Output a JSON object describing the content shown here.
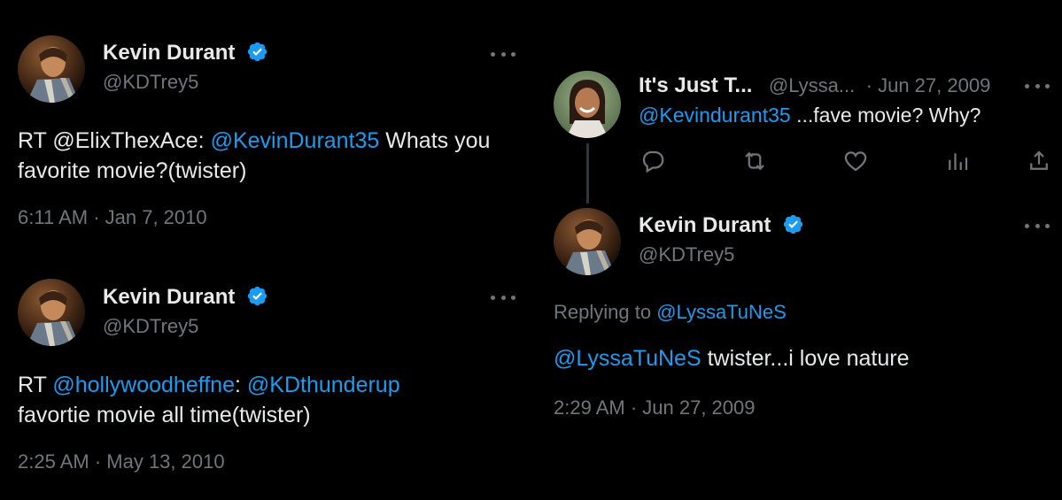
{
  "left_tweets": [
    {
      "name": "Kevin Durant",
      "handle": "@KDTrey5",
      "body_prefix": "RT @ElixThexAce: ",
      "body_link": "@KevinDurant35",
      "body_rest": " Whats you favorite movie?(twister)",
      "time": "6:11 AM · Jan 7, 2010"
    },
    {
      "name": "Kevin Durant",
      "handle": "@KDTrey5",
      "body_prefix": "RT ",
      "body_link1": "@hollywoodheffne",
      "body_sep": ": ",
      "body_link2": "@KDthunderup",
      "body_rest": "favortie movie all time(twister)",
      "time": "2:25 AM · May 13, 2010"
    }
  ],
  "right_thread": {
    "parent": {
      "name": "It's Just T...",
      "handle": "@Lyssa...",
      "date": "· Jun 27, 2009",
      "mention": "@Kevindurant35",
      "text": " ...fave movie? Why?",
      "actions": [
        "reply-icon",
        "retweet-icon",
        "like-icon",
        "views-icon",
        "share-icon"
      ]
    },
    "reply": {
      "name": "Kevin Durant",
      "handle": "@KDTrey5",
      "replying_prefix": "Replying to ",
      "replying_handle": "@LyssaTuNeS",
      "mention": "@LyssaTuNeS",
      "text": " twister...i love nature",
      "time": "2:29 AM · Jun 27, 2009"
    }
  },
  "colors": {
    "background": "#000000",
    "text": "#e7e9ea",
    "muted": "#71767b",
    "link": "#1d9bf0"
  }
}
